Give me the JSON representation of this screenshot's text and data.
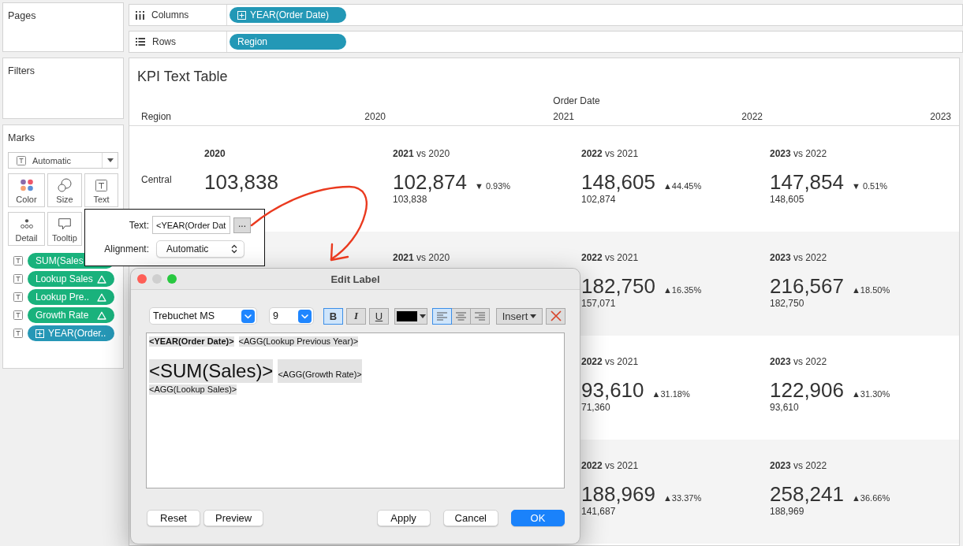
{
  "sidebar": {
    "pages": {
      "title": "Pages"
    },
    "filters": {
      "title": "Filters"
    },
    "marks": {
      "title": "Marks",
      "mark_type": "Automatic",
      "cards": [
        {
          "kind": "color",
          "label": "Color"
        },
        {
          "kind": "size",
          "label": "Size"
        },
        {
          "kind": "text",
          "label": "Text"
        },
        {
          "kind": "detail",
          "label": "Detail"
        },
        {
          "kind": "tooltip",
          "label": "Tooltip"
        }
      ],
      "fields": [
        {
          "label": "SUM(Sales",
          "color": "#19b27c",
          "table_calc": false,
          "drillable": false
        },
        {
          "label": "Lookup Sales",
          "color": "#19b27c",
          "table_calc": true,
          "drillable": false
        },
        {
          "label": "Lookup Pre..",
          "color": "#19b27c",
          "table_calc": true,
          "drillable": false
        },
        {
          "label": "Growth Rate",
          "color": "#19b27c",
          "table_calc": true,
          "drillable": false
        },
        {
          "label": "YEAR(Order..",
          "color": "#2697b6",
          "table_calc": false,
          "drillable": true
        }
      ]
    }
  },
  "shelves": [
    {
      "kind": "columns",
      "label": "Columns",
      "pill": {
        "label": "YEAR(Order Date)",
        "drillable": true
      }
    },
    {
      "kind": "rows",
      "label": "Rows",
      "pill": {
        "label": "Region",
        "drillable": false
      }
    }
  ],
  "view": {
    "title": "KPI Text Table",
    "column_group": "Order Date",
    "row_header": "Region",
    "columns": [
      "2020",
      "2021",
      "2022",
      "2023"
    ],
    "rows": [
      {
        "region": "Central",
        "cells": [
          {
            "year": "2020",
            "value": "103,838"
          },
          {
            "year": "2021",
            "compare": "vs 2020",
            "value": "102,874",
            "change": "▼ 0.93%",
            "previous": "103,838"
          },
          {
            "year": "2022",
            "compare": "vs 2021",
            "value": "148,605",
            "change": "▲44.45%",
            "previous": "102,874"
          },
          {
            "year": "2023",
            "compare": "vs 2022",
            "value": "147,854",
            "change": "▼ 0.51%",
            "previous": "148,605"
          }
        ]
      },
      {
        "cells": [
          null,
          {
            "year": "2021",
            "compare": "vs 2020"
          },
          {
            "year": "2022",
            "compare": "vs 2021",
            "value": "182,750",
            "change": "▲16.35%",
            "previous": "157,071"
          },
          {
            "year": "2023",
            "compare": "vs 2022",
            "value": "216,567",
            "change": "▲18.50%",
            "previous": "182,750"
          }
        ]
      },
      {
        "cells": [
          null,
          null,
          {
            "year": "2022",
            "compare": "vs 2021",
            "value": "93,610",
            "change": "▲31.18%",
            "previous": "71,360"
          },
          {
            "year": "2023",
            "compare": "vs 2022",
            "value": "122,906",
            "change": "▲31.30%",
            "previous": "93,610"
          }
        ]
      },
      {
        "cells": [
          null,
          null,
          {
            "year": "2022",
            "compare": "vs 2021",
            "value": "188,969",
            "change": "▲33.37%",
            "previous": "141,687"
          },
          {
            "year": "2023",
            "compare": "vs 2022",
            "value": "258,241",
            "change": "▲36.66%",
            "previous": "188,969"
          }
        ]
      }
    ]
  },
  "text_popup": {
    "text_label": "Text:",
    "text_value": "<YEAR(Order Dat",
    "more_button": "...",
    "alignment_label": "Alignment:",
    "alignment_value": "Automatic"
  },
  "dialog": {
    "title": "Edit Label",
    "window_buttons": [
      {
        "kind": "close",
        "disabled": false
      },
      {
        "kind": "minimize",
        "disabled": true
      },
      {
        "kind": "zoom",
        "disabled": false
      }
    ],
    "font_menu": "Trebuchet MS",
    "size_menu": "9",
    "styles": [
      {
        "kind": "bold",
        "label": "B",
        "selected": true
      },
      {
        "kind": "italic",
        "label": "I",
        "selected": false
      },
      {
        "kind": "underline",
        "label": "U",
        "selected": false
      }
    ],
    "alignments": [
      {
        "kind": "left",
        "selected": true
      },
      {
        "kind": "center",
        "selected": false
      },
      {
        "kind": "right",
        "selected": false
      }
    ],
    "insert": "Insert",
    "lines": [
      [
        {
          "kind": "header",
          "text": "<YEAR(Order Date)>"
        },
        {
          "kind": "field",
          "text": "<AGG(Lookup Previous Year)>"
        }
      ],
      [
        {
          "kind": "value",
          "text": "<SUM(Sales)>"
        },
        {
          "kind": "field",
          "text": "<AGG(Growth Rate)>"
        }
      ],
      [
        {
          "kind": "field",
          "text": "<AGG(Lookup Sales)>"
        }
      ]
    ],
    "buttons_left": [
      {
        "label": "Reset",
        "default": false
      },
      {
        "label": "Preview",
        "default": false
      }
    ],
    "buttons_right": [
      {
        "label": "Apply",
        "default": false
      },
      {
        "label": "Cancel",
        "default": false
      },
      {
        "label": "OK",
        "default": true
      }
    ]
  }
}
